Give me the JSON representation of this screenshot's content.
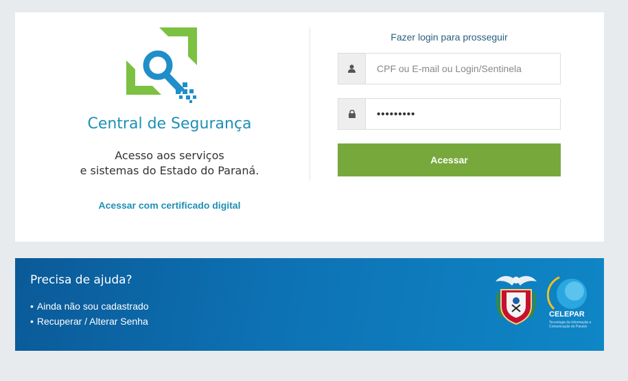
{
  "login": {
    "app_title": "Central de Segurança",
    "subtitle_line1": "Acesso aos serviços",
    "subtitle_line2": "e sistemas do Estado do Paraná.",
    "cert_link": "Acessar com certificado digital",
    "heading": "Fazer login para prosseguir",
    "username_placeholder": "CPF ou E-mail ou Login/Sentinela",
    "password_value": "•••••••••",
    "submit_label": "Acessar"
  },
  "help": {
    "title": "Precisa de ajuda?",
    "links": [
      {
        "label": "Ainda não sou cadastrado"
      },
      {
        "label": "Recuperar / Alterar Senha"
      }
    ]
  },
  "footer": {
    "celepar_name": "CELEPAR",
    "celepar_tagline": "Tecnologia da Informação e Comunicação do Paraná"
  },
  "colors": {
    "brand_blue": "#1e8fb5",
    "logo_green": "#7cc142",
    "button_green": "#76a83b",
    "help_blue": "#0d72b4"
  },
  "icons": {
    "logo": "key-magnifier-logo-icon",
    "username": "user-icon",
    "password": "lock-icon",
    "crest": "parana-coat-of-arms-icon",
    "celepar": "celepar-globe-icon"
  }
}
